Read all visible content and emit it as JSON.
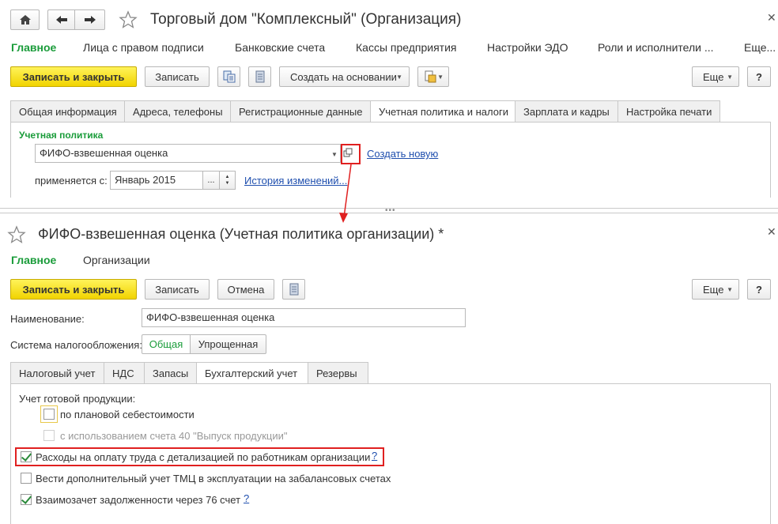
{
  "window1": {
    "title": "Торговый дом \"Комплексный\" (Организация)",
    "nav": [
      {
        "label": "Главное",
        "active": true
      },
      {
        "label": "Лица с правом подписи"
      },
      {
        "label": "Банковские счета"
      },
      {
        "label": "Кассы предприятия"
      },
      {
        "label": "Настройки ЭДО"
      },
      {
        "label": "Роли и исполнители ..."
      },
      {
        "label": "Еще..."
      }
    ],
    "toolbar": {
      "save_close": "Записать и закрыть",
      "save": "Записать",
      "create_based": "Создать на основании",
      "more": "Еще",
      "help": "?"
    },
    "tabs": [
      {
        "label": "Общая информация"
      },
      {
        "label": "Адреса, телефоны"
      },
      {
        "label": "Регистрационные данные"
      },
      {
        "label": "Учетная политика и налоги",
        "active": true
      },
      {
        "label": "Зарплата и кадры"
      },
      {
        "label": "Настройка печати"
      }
    ],
    "policy": {
      "section_label": "Учетная политика",
      "value": "ФИФО-взвешенная оценка",
      "create_new": "Создать новую",
      "applies_label": "применяется с:",
      "applies_value": "Январь 2015",
      "history_link": "История изменений..."
    }
  },
  "window2": {
    "title": "ФИФО-взвешенная оценка (Учетная политика организации) *",
    "nav": [
      {
        "label": "Главное",
        "active": true
      },
      {
        "label": "Организации"
      }
    ],
    "toolbar": {
      "save_close": "Записать и закрыть",
      "save": "Записать",
      "cancel": "Отмена",
      "more": "Еще",
      "help": "?"
    },
    "name_label": "Наименование:",
    "name_value": "ФИФО-взвешенная оценка",
    "tax_label": "Система налогообложения:",
    "tax_options": [
      {
        "label": "Общая",
        "active": true
      },
      {
        "label": "Упрощенная"
      }
    ],
    "tabs": [
      {
        "label": "Налоговый учет"
      },
      {
        "label": "НДС"
      },
      {
        "label": "Запасы"
      },
      {
        "label": "Бухгалтерский учет",
        "active": true
      },
      {
        "label": "Резервы"
      }
    ],
    "accounting": {
      "products_label": "Учет готовой продукции:",
      "opt_planned": {
        "label": "по плановой себестоимости",
        "checked": false
      },
      "opt_account40": {
        "label": "с использованием счета 40 \"Выпуск продукции\"",
        "checked": false,
        "disabled": true
      },
      "opt_salary": {
        "label": "Расходы на оплату труда с детализацией по работникам организации",
        "checked": true,
        "help": "?"
      },
      "opt_offbalance": {
        "label": "Вести дополнительный учет ТМЦ в эксплуатации на забалансовых счетах",
        "checked": false
      },
      "opt_offset": {
        "label": "Взаимозачет задолженности через 76 счет",
        "checked": true,
        "help": "?"
      }
    }
  },
  "colors": {
    "accent_green": "#1a9c3a",
    "primary_button": "#f5dc16",
    "link_blue": "#1f4fae",
    "highlight_red": "#e02020"
  }
}
